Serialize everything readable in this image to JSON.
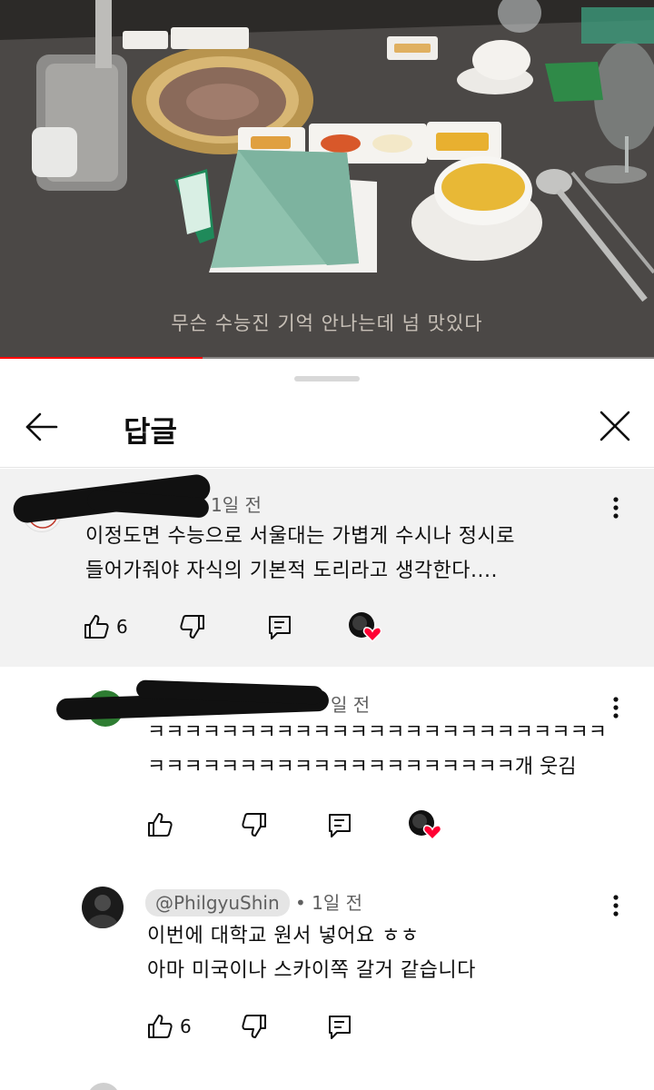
{
  "video": {
    "subtitle": "무슨 수능진 기억 안나는데 넘 맛있다",
    "progress_fraction": 0.31
  },
  "sheet": {
    "title": "답글",
    "back_icon": "arrow-left-icon",
    "close_icon": "close-icon"
  },
  "comments": [
    {
      "time": "1일 전",
      "lines": [
        "이정도면 수능으로 서울대는 가볍게 수시나 정시로",
        "들어가줘야 자식의 기본적 도리라고 생각한다...."
      ],
      "likes": "6",
      "hearted": true
    },
    {
      "time": "일 전",
      "lines": [
        "ㅋㅋㅋㅋㅋㅋㅋㅋㅋㅋㅋㅋㅋㅋㅋㅋㅋㅋㅋㅋㅋㅋㅋㅋㅋ",
        "ㅋㅋㅋㅋㅋㅋㅋㅋㅋㅋㅋㅋㅋㅋㅋㅋㅋㅋㅋㅋ개 웃김"
      ],
      "likes": "",
      "hearted": true,
      "avatar_color": "#2e7d32"
    },
    {
      "handle": "@PhilgyuShin",
      "time": "• 1일 전",
      "lines": [
        "이번에 대학교 원서 넣어요 ㅎㅎ",
        "아마 미국이나 스카이쪽 갈거 같습니다"
      ],
      "likes": "6",
      "hearted": false
    }
  ],
  "colors": {
    "heart": "#ff0033",
    "progress": "#ff0000",
    "highlight_bg": "#f2f2f2"
  }
}
